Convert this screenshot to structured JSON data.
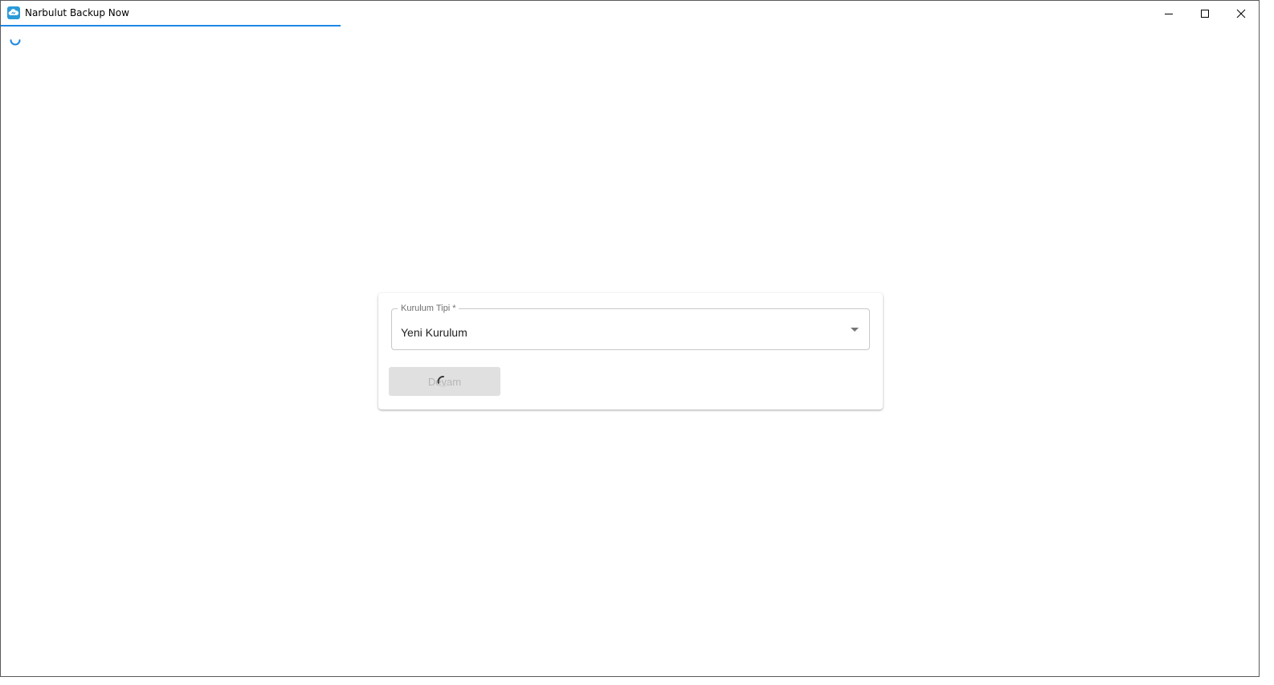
{
  "window": {
    "title": "Narbulut Backup Now",
    "controls": {
      "minimize": "minimize-icon",
      "maximize": "maximize-icon",
      "close": "close-icon"
    }
  },
  "form": {
    "installation_type": {
      "label": "Kurulum Tipi *",
      "value": "Yeni Kurulum"
    },
    "continue_label": "Devam"
  },
  "colors": {
    "accent": "#1e88e5",
    "button_disabled_bg": "#e0e0e0"
  }
}
